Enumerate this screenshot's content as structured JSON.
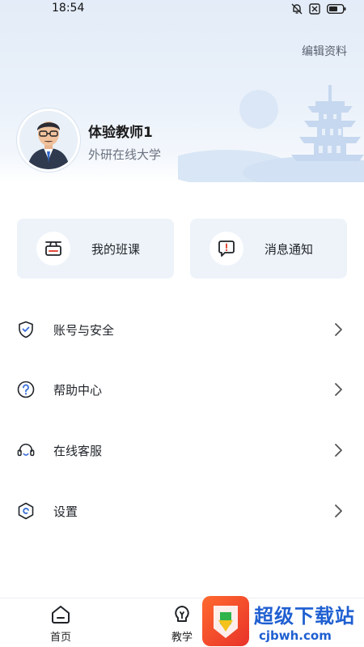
{
  "status_bar": {
    "time": "18:54"
  },
  "header": {
    "edit_profile": "编辑资料"
  },
  "profile": {
    "name": "体验教师1",
    "organization": "外研在线大学"
  },
  "quick_cards": [
    {
      "label": "我的班课",
      "icon": "classroom-icon"
    },
    {
      "label": "消息通知",
      "icon": "message-alert-icon"
    }
  ],
  "menu": [
    {
      "label": "账号与安全",
      "icon": "shield-check-icon"
    },
    {
      "label": "帮助中心",
      "icon": "question-circle-icon"
    },
    {
      "label": "在线客服",
      "icon": "headset-icon"
    },
    {
      "label": "设置",
      "icon": "hexagon-settings-icon"
    }
  ],
  "tabbar": [
    {
      "label": "首页",
      "icon": "home-icon"
    },
    {
      "label": "教学",
      "icon": "bulb-icon"
    }
  ],
  "watermark": {
    "title": "超级下载站",
    "url": "cjbwh.com"
  },
  "colors": {
    "hero_bg": "#e3ecf8",
    "card_bg": "#eef3fa",
    "accent": "#3a6fd8",
    "alert": "#e24a3b"
  }
}
